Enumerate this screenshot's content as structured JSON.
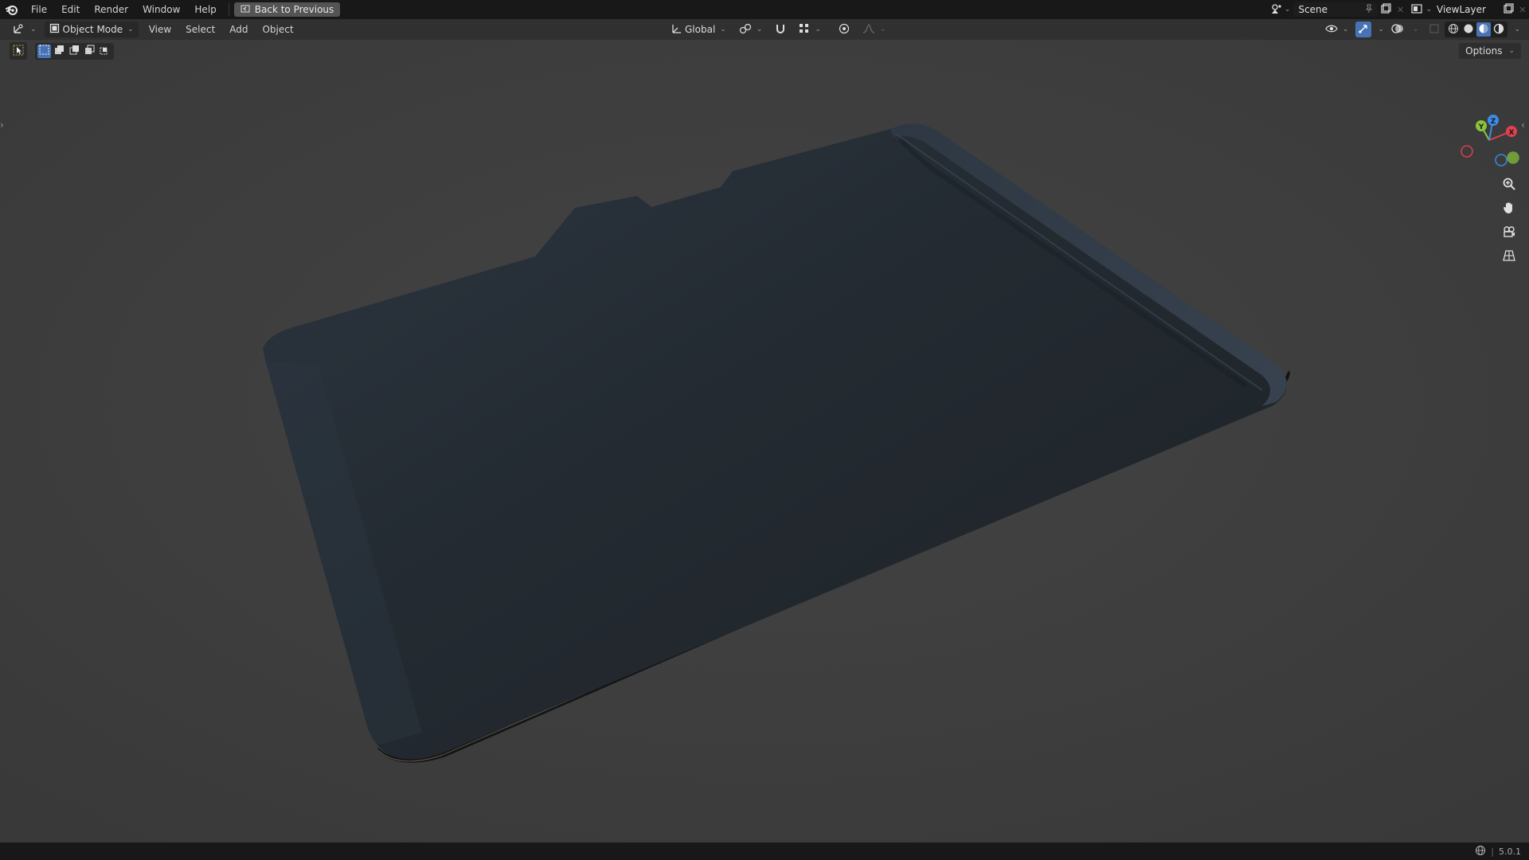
{
  "topbar": {
    "menu": [
      "File",
      "Edit",
      "Render",
      "Window",
      "Help"
    ],
    "back_label": "Back to Previous",
    "scene_name": "Scene",
    "viewlayer_name": "ViewLayer"
  },
  "header": {
    "mode_label": "Object Mode",
    "menus": [
      "View",
      "Select",
      "Add",
      "Object"
    ],
    "orientation_label": "Global",
    "active_shading": "material-preview"
  },
  "viewport": {
    "options_label": "Options",
    "gizmo_axes": [
      "X",
      "Y",
      "Z"
    ]
  },
  "status": {
    "version": "5.0.1"
  },
  "colors": {
    "accent": "#4772b3",
    "axis_x": "#e0414f",
    "axis_y": "#8ac43c",
    "axis_z": "#3b8ee8",
    "object": "#232a30"
  }
}
